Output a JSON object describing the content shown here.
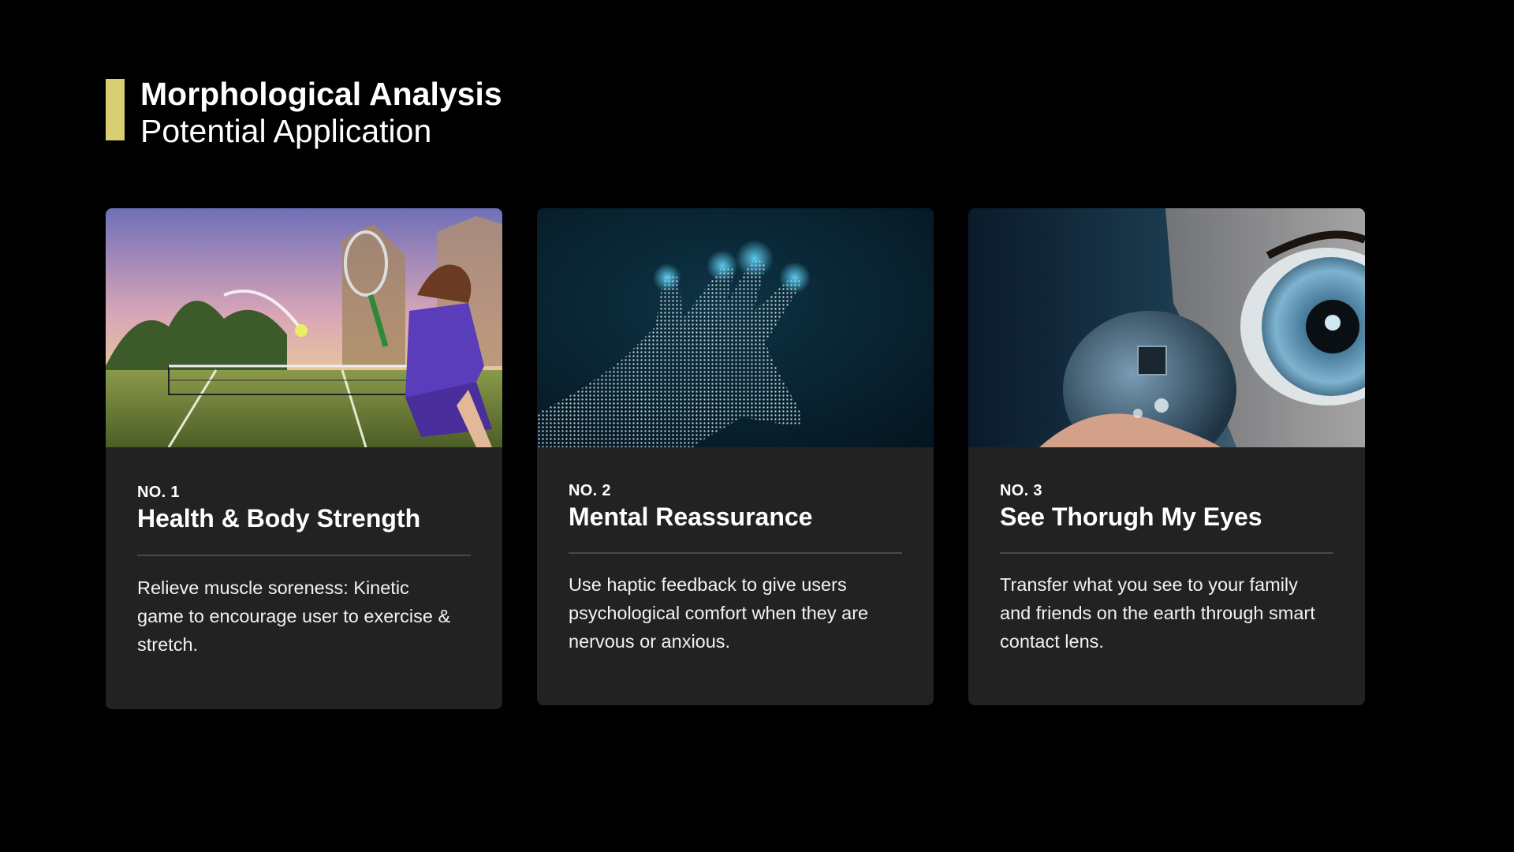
{
  "header": {
    "title": "Morphological Analysis",
    "subtitle": "Potential Application",
    "accent_color": "#d9cf72"
  },
  "cards": [
    {
      "number": "NO. 1",
      "title": "Health & Body Strength",
      "description": "Relieve muscle soreness: Kinetic game to encourage user to exercise & stretch.",
      "image": "tennis-game-image"
    },
    {
      "number": "NO. 2",
      "title": "Mental Reassurance",
      "description": "Use haptic feedback to give users psychological comfort when they are nervous or anxious.",
      "image": "digital-hand-image"
    },
    {
      "number": "NO. 3",
      "title": "See Thorugh My Eyes",
      "description": "Transfer what you see to your family and friends on the earth through smart contact lens.",
      "image": "smart-contact-lens-image"
    }
  ],
  "colors": {
    "background": "#000000",
    "card_background": "#232223",
    "divider": "#4a494a"
  }
}
